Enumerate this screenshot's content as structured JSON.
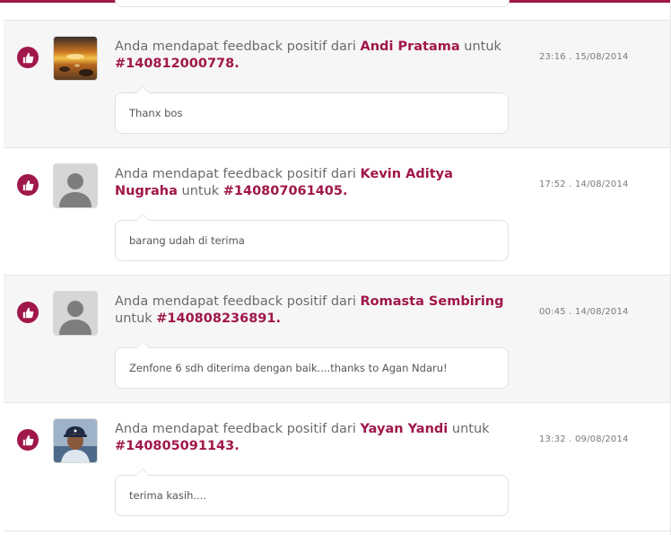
{
  "feed": {
    "items": [
      {
        "prefix": "Anda mendapat feedback positif dari",
        "user": "Andi Pratama",
        "mid": "untuk",
        "order": "#140812000778",
        "suffix": ".",
        "time": "23:16 . 15/08/2014",
        "comment": "Thanx bos",
        "avatar": "sunset-photo"
      },
      {
        "prefix": "Anda mendapat feedback positif dari",
        "user": "Kevin Aditya Nugraha",
        "mid": "untuk",
        "order": "#140807061405",
        "suffix": ".",
        "time": "17:52 . 14/08/2014",
        "comment": "barang udah di terima",
        "avatar": "default-user"
      },
      {
        "prefix": "Anda mendapat feedback positif dari",
        "user": "Romasta Sembiring",
        "mid": "untuk",
        "order": "#140808236891",
        "suffix": ".",
        "time": "00:45 . 14/08/2014",
        "comment": "Zenfone 6 sdh diterima dengan baik....thanks to Agan Ndaru!",
        "avatar": "default-user"
      },
      {
        "prefix": "Anda mendapat feedback positif dari",
        "user": "Yayan Yandi",
        "mid": "untuk",
        "order": "#140805091143",
        "suffix": ".",
        "time": "13:32 . 09/08/2014",
        "comment": "terima kasih....",
        "avatar": "man-with-cap-photo"
      }
    ]
  },
  "icons": {
    "badge": "thumbs-up-icon"
  },
  "colors": {
    "accent": "#a0174a",
    "text": "#6b6b6b",
    "row_shaded": "#f6f6f6"
  }
}
